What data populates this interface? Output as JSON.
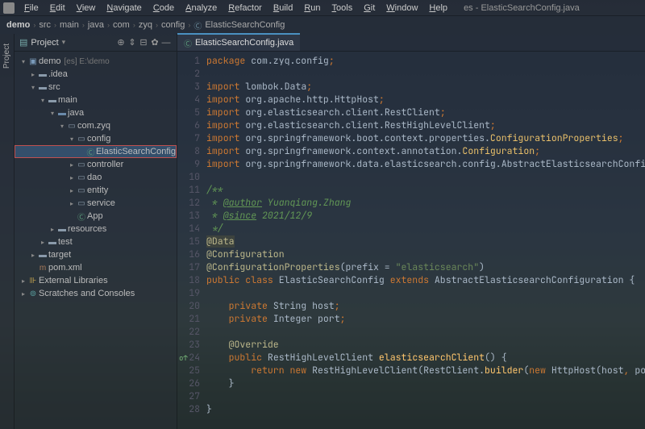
{
  "window_title": "es - ElasticSearchConfig.java",
  "menu": [
    "File",
    "Edit",
    "View",
    "Navigate",
    "Code",
    "Analyze",
    "Refactor",
    "Build",
    "Run",
    "Tools",
    "Git",
    "Window",
    "Help"
  ],
  "breadcrumb": [
    "demo",
    "src",
    "main",
    "java",
    "com",
    "zyq",
    "config",
    "ElasticSearchConfig"
  ],
  "project_label": "Project",
  "leftbar_label": "Project",
  "tree": [
    {
      "d": 0,
      "a": "v",
      "i": "module",
      "t": "demo",
      "hint": "[es] E:\\demo"
    },
    {
      "d": 1,
      "a": ">",
      "i": "folder",
      "t": ".idea"
    },
    {
      "d": 1,
      "a": "v",
      "i": "folder",
      "t": "src"
    },
    {
      "d": 2,
      "a": "v",
      "i": "folder",
      "t": "main"
    },
    {
      "d": 3,
      "a": "v",
      "i": "java",
      "t": "java"
    },
    {
      "d": 4,
      "a": "v",
      "i": "pkg",
      "t": "com.zyq"
    },
    {
      "d": 5,
      "a": "v",
      "i": "pkg",
      "t": "config"
    },
    {
      "d": 6,
      "a": "",
      "i": "class",
      "t": "ElasticSearchConfig",
      "sel": true
    },
    {
      "d": 5,
      "a": ">",
      "i": "pkg",
      "t": "controller"
    },
    {
      "d": 5,
      "a": ">",
      "i": "pkg",
      "t": "dao"
    },
    {
      "d": 5,
      "a": ">",
      "i": "pkg",
      "t": "entity"
    },
    {
      "d": 5,
      "a": ">",
      "i": "pkg",
      "t": "service"
    },
    {
      "d": 5,
      "a": "",
      "i": "class",
      "t": "App"
    },
    {
      "d": 3,
      "a": ">",
      "i": "folder",
      "t": "resources"
    },
    {
      "d": 2,
      "a": ">",
      "i": "folder",
      "t": "test"
    },
    {
      "d": 1,
      "a": ">",
      "i": "folder",
      "t": "target"
    },
    {
      "d": 1,
      "a": "",
      "i": "file",
      "t": "pom.xml"
    },
    {
      "d": 0,
      "a": ">",
      "i": "lib",
      "t": "External Libraries"
    },
    {
      "d": 0,
      "a": ">",
      "i": "scratch",
      "t": "Scratches and Consoles"
    }
  ],
  "tab": {
    "icon": "C",
    "label": "ElasticSearchConfig.java"
  },
  "code": [
    {
      "n": 1,
      "t": [
        [
          "kw",
          "package "
        ],
        [
          "pkg",
          "com.zyq.config"
        ],
        [
          "pun",
          ";"
        ]
      ]
    },
    {
      "n": 2,
      "t": []
    },
    {
      "n": 3,
      "t": [
        [
          "kw",
          "import "
        ],
        [
          "pkg",
          "lombok."
        ],
        [
          "id",
          "Data"
        ],
        [
          "pun",
          ";"
        ]
      ]
    },
    {
      "n": 4,
      "t": [
        [
          "kw",
          "import "
        ],
        [
          "pkg",
          "org.apache.http."
        ],
        [
          "id",
          "HttpHost"
        ],
        [
          "pun",
          ";"
        ]
      ]
    },
    {
      "n": 5,
      "t": [
        [
          "kw",
          "import "
        ],
        [
          "pkg",
          "org.elasticsearch.client."
        ],
        [
          "id",
          "RestClient"
        ],
        [
          "pun",
          ";"
        ]
      ]
    },
    {
      "n": 6,
      "t": [
        [
          "kw",
          "import "
        ],
        [
          "pkg",
          "org.elasticsearch.client."
        ],
        [
          "id",
          "RestHighLevelClient"
        ],
        [
          "pun",
          ";"
        ]
      ]
    },
    {
      "n": 7,
      "t": [
        [
          "kw",
          "import "
        ],
        [
          "pkg",
          "org.springframework.boot.context.properties."
        ],
        [
          "cls",
          "ConfigurationProperties"
        ],
        [
          "pun",
          ";"
        ]
      ]
    },
    {
      "n": 8,
      "t": [
        [
          "kw",
          "import "
        ],
        [
          "pkg",
          "org.springframework.context.annotation."
        ],
        [
          "cls",
          "Configuration"
        ],
        [
          "pun",
          ";"
        ]
      ]
    },
    {
      "n": 9,
      "t": [
        [
          "kw",
          "import "
        ],
        [
          "pkg",
          "org.springframework.data.elasticsearch.config."
        ],
        [
          "id",
          "AbstractElasticsearchConfiguration"
        ],
        [
          "pun",
          ";"
        ]
      ]
    },
    {
      "n": 10,
      "t": []
    },
    {
      "n": 11,
      "t": [
        [
          "com-star",
          "/**"
        ]
      ]
    },
    {
      "n": 12,
      "t": [
        [
          "com-star",
          " * "
        ],
        [
          "tag",
          "@author"
        ],
        [
          "com-star",
          " Yuanqiang.Zhang"
        ]
      ]
    },
    {
      "n": 13,
      "t": [
        [
          "com-star",
          " * "
        ],
        [
          "tag",
          "@since"
        ],
        [
          "com-star",
          " 2021/12/9"
        ]
      ]
    },
    {
      "n": 14,
      "t": [
        [
          "com-star",
          " */"
        ]
      ]
    },
    {
      "n": 15,
      "t": [
        [
          "ann",
          "@Data"
        ]
      ],
      "hl": true
    },
    {
      "n": 16,
      "t": [
        [
          "ann",
          "@Configuration"
        ]
      ]
    },
    {
      "n": 17,
      "t": [
        [
          "ann",
          "@ConfigurationProperties"
        ],
        [
          "id",
          "(prefix = "
        ],
        [
          "str",
          "\"elasticsearch\""
        ],
        [
          "id",
          ")"
        ]
      ]
    },
    {
      "n": 18,
      "t": [
        [
          "kw",
          "public class "
        ],
        [
          "id",
          "ElasticSearchConfig "
        ],
        [
          "kw",
          "extends "
        ],
        [
          "id",
          "AbstractElasticsearchConfiguration {"
        ]
      ]
    },
    {
      "n": 19,
      "t": []
    },
    {
      "n": 20,
      "t": [
        [
          "id",
          "    "
        ],
        [
          "kw",
          "private "
        ],
        [
          "id",
          "String host"
        ],
        [
          "pun",
          ";"
        ]
      ]
    },
    {
      "n": 21,
      "t": [
        [
          "id",
          "    "
        ],
        [
          "kw",
          "private "
        ],
        [
          "id",
          "Integer port"
        ],
        [
          "pun",
          ";"
        ]
      ]
    },
    {
      "n": 22,
      "t": []
    },
    {
      "n": 23,
      "t": [
        [
          "id",
          "    "
        ],
        [
          "ann",
          "@Override"
        ]
      ]
    },
    {
      "n": 24,
      "t": [
        [
          "id",
          "    "
        ],
        [
          "kw",
          "public "
        ],
        [
          "id",
          "RestHighLevelClient "
        ],
        [
          "def",
          "elasticsearchClient"
        ],
        [
          "id",
          "() {"
        ]
      ],
      "mark": "o↑"
    },
    {
      "n": 25,
      "t": [
        [
          "id",
          "        "
        ],
        [
          "kw",
          "return new "
        ],
        [
          "id",
          "RestHighLevelClient(RestClient."
        ],
        [
          "def",
          "builder"
        ],
        [
          "id",
          "("
        ],
        [
          "kw",
          "new "
        ],
        [
          "id",
          "HttpHost(host"
        ],
        [
          "pun",
          ", "
        ],
        [
          "id",
          "port)))"
        ],
        [
          "pun",
          ";"
        ]
      ]
    },
    {
      "n": 26,
      "t": [
        [
          "id",
          "    }"
        ]
      ]
    },
    {
      "n": 27,
      "t": []
    },
    {
      "n": 28,
      "t": [
        [
          "id",
          "}"
        ]
      ]
    }
  ]
}
